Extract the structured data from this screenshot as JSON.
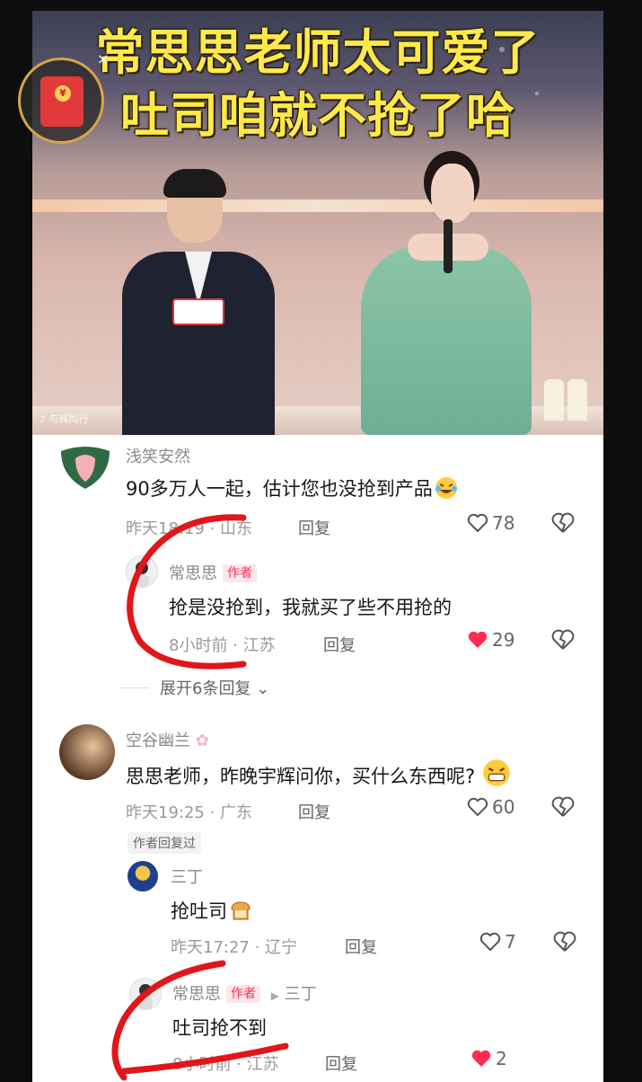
{
  "overlay": {
    "title_line1": "常思思老师太可爱了",
    "title_line2": "吐司咱就不抢了哈",
    "watermark": "与辉同行",
    "redpacket_coin": "¥"
  },
  "comments": [
    {
      "username": "浅笑安然",
      "text": "90多万人一起，估计您也没抢到产品",
      "emoji": "crying-laughing-emoji",
      "time": "昨天18:19",
      "location": "山东",
      "reply_label": "回复",
      "likes": "78",
      "replies": [
        {
          "username": "常思思",
          "badge": "作者",
          "text": "抢是没抢到，我就买了些不用抢的",
          "time": "8小时前",
          "location": "江苏",
          "reply_label": "回复",
          "likes": "29",
          "liked": true
        }
      ],
      "expand_label": "展开6条回复"
    },
    {
      "username": "空谷幽兰",
      "text": "思思老师，昨晚宇辉问你，买什么东西呢?",
      "emoji": "grinning-emoji",
      "time": "昨天19:25",
      "location": "广东",
      "reply_label": "回复",
      "likes": "60",
      "author_replied_tag": "作者回复过",
      "replies": [
        {
          "username": "三丁",
          "text": "抢吐司",
          "emoji": "bread-emoji",
          "time": "昨天17:27",
          "location": "辽宁",
          "reply_label": "回复",
          "likes": "7",
          "liked": false
        },
        {
          "username": "常思思",
          "badge": "作者",
          "reply_to": "三丁",
          "text": "吐司抢不到",
          "time": "8小时前",
          "location": "江苏",
          "reply_label": "回复",
          "likes": "2",
          "liked": true
        }
      ]
    }
  ],
  "colors": {
    "liked_heart": "#fe2c55",
    "annotation_red": "#e0161b",
    "title_yellow": "#ffe94a"
  }
}
